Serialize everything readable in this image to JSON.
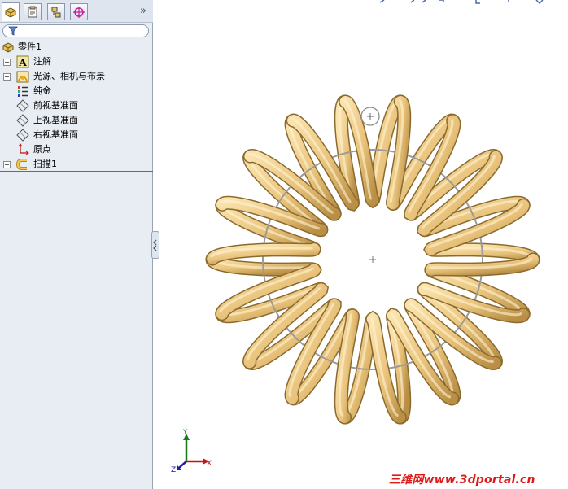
{
  "tabs": [
    {
      "name": "feature-manager-tab",
      "active": true
    },
    {
      "name": "property-manager-tab",
      "active": false
    },
    {
      "name": "configuration-manager-tab",
      "active": false
    },
    {
      "name": "dimxpert-manager-tab",
      "active": false
    }
  ],
  "more_glyph": "»",
  "tree": {
    "root": "零件1",
    "items": [
      {
        "label": "注解",
        "icon": "annotation-icon",
        "expandable": true
      },
      {
        "label": "光源、相机与布景",
        "icon": "lights-cameras-icon",
        "expandable": true
      },
      {
        "label": "纯金",
        "icon": "material-icon",
        "expandable": false
      },
      {
        "label": "前视基准面",
        "icon": "plane-icon",
        "expandable": false
      },
      {
        "label": "上视基准面",
        "icon": "plane-icon",
        "expandable": false
      },
      {
        "label": "右视基准面",
        "icon": "plane-icon",
        "expandable": false
      },
      {
        "label": "原点",
        "icon": "origin-icon",
        "expandable": false
      },
      {
        "label": "扫描1",
        "icon": "sweep-feature-icon",
        "expandable": true
      }
    ]
  },
  "triad": {
    "x": "X",
    "y": "Y",
    "z": "Z"
  },
  "watermark": "三维网www.3dportal.cn",
  "colors": {
    "coil": "#e8c27a",
    "coil_shadow": "#8a6a2e",
    "path_circle": "#9a9a9a",
    "panel": "#e8ecf3"
  }
}
